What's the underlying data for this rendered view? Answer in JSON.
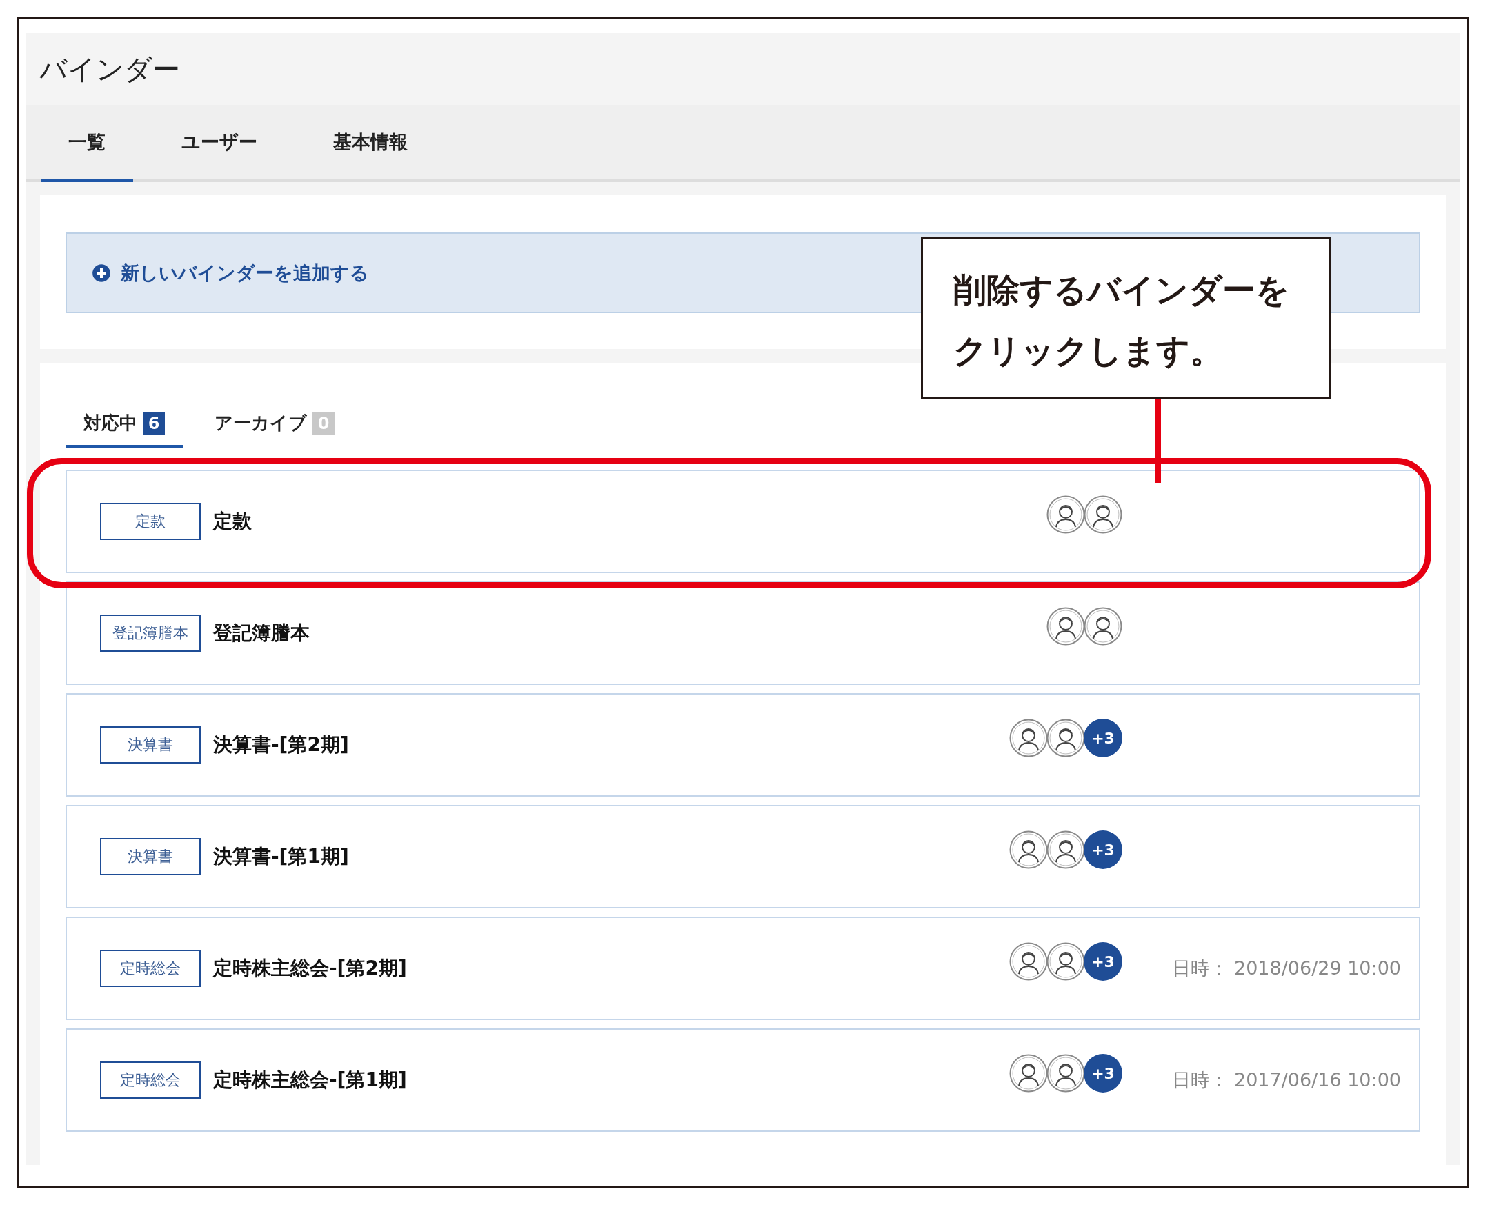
{
  "page_title": "バインダー",
  "tabs": [
    {
      "label": "一覧",
      "selected": true
    },
    {
      "label": "ユーザー",
      "selected": false
    },
    {
      "label": "基本情報",
      "selected": false
    }
  ],
  "add_link": "新しいバインダーを追加する",
  "sub_tabs": [
    {
      "label": "対応中",
      "count": "6",
      "selected": true
    },
    {
      "label": "アーカイブ",
      "count": "0",
      "selected": false
    }
  ],
  "binders": [
    {
      "tag": "定款",
      "title": "定款",
      "avatars": [
        {
          "kind": "person"
        },
        {
          "kind": "person"
        }
      ],
      "highlighted": true
    },
    {
      "tag": "登記簿謄本",
      "title": "登記簿謄本",
      "avatars": [
        {
          "kind": "person"
        },
        {
          "kind": "person"
        }
      ],
      "highlighted": false
    },
    {
      "tag": "決算書",
      "title": "決算書-[第2期]",
      "avatars": [
        {
          "kind": "person"
        },
        {
          "kind": "person"
        }
      ],
      "more": "+3",
      "highlighted": false
    },
    {
      "tag": "決算書",
      "title": "決算書-[第1期]",
      "avatars": [
        {
          "kind": "person"
        },
        {
          "kind": "person"
        }
      ],
      "more": "+3",
      "highlighted": false
    },
    {
      "tag": "定時総会",
      "title": "定時株主総会-[第2期]",
      "avatars": [
        {
          "kind": "person"
        },
        {
          "kind": "person"
        }
      ],
      "more": "+3",
      "date": "日時： 2018/06/29 10:00",
      "highlighted": false
    },
    {
      "tag": "定時総会",
      "title": "定時株主総会-[第1期]",
      "avatars": [
        {
          "kind": "person"
        },
        {
          "kind": "person"
        }
      ],
      "more": "+3",
      "date": "日時： 2017/06/16 10:00",
      "highlighted": false
    }
  ],
  "callout": {
    "text": "削除するバインダーをクリックします。"
  }
}
